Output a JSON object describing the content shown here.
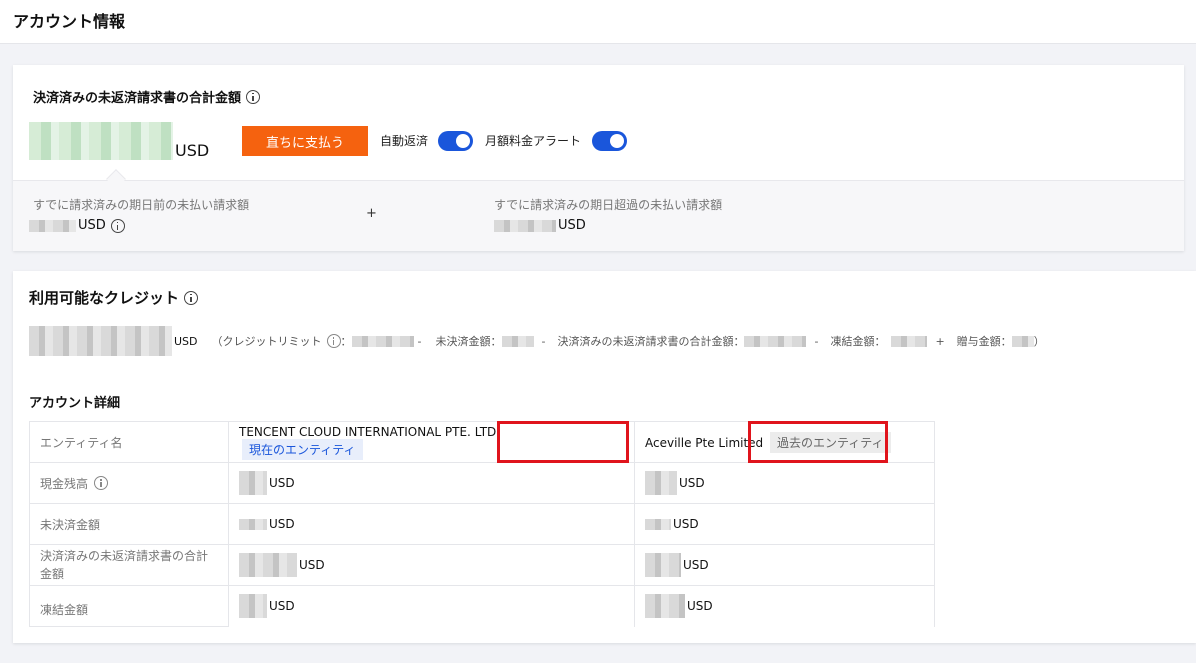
{
  "header": {
    "title": "アカウント情報"
  },
  "bill_summary": {
    "title": "決済済みの未返済請求書の合計金額",
    "amount_unit": "USD",
    "pay_button": "直ちに支払う",
    "auto_repay_label": "自動返済",
    "auto_repay_on": true,
    "monthly_alert_label": "月額料金アラート",
    "monthly_alert_on": true,
    "before_due": {
      "label": "すでに請求済みの期日前の未払い請求額",
      "unit": "USD"
    },
    "plus": "+",
    "overdue": {
      "label": "すでに請求済みの期日超過の未払い請求額",
      "unit": "USD"
    }
  },
  "credit": {
    "title": "利用可能なクレジット",
    "unit": "USD",
    "open_paren": "（クレジットリミット",
    "colon": "：",
    "minus": "-",
    "outstanding_label": "未決済金額：",
    "unpaid_total_label": "決済済みの未返済請求書の合計金額：",
    "frozen_label": "凍結金額：",
    "plus": "+",
    "gift_label": "贈与金額：",
    "close_paren": "）"
  },
  "account_details": {
    "title": "アカウント詳細",
    "row_labels": [
      "エンティティ名",
      "現金残高",
      "未決済金額",
      "決済済みの未返済請求書の合計金額",
      "凍結金額"
    ],
    "entities": [
      {
        "name": "TENCENT CLOUD INTERNATIONAL PTE. LTD.",
        "tag": "現在のエンティティ",
        "unit": "USD"
      },
      {
        "name": "Aceville Pte Limited",
        "tag": "過去のエンティティ",
        "unit": "USD"
      }
    ]
  },
  "colors": {
    "pay_button": "#f5620f",
    "toggle": "#1a56db",
    "highlight_box": "#e0141c"
  }
}
